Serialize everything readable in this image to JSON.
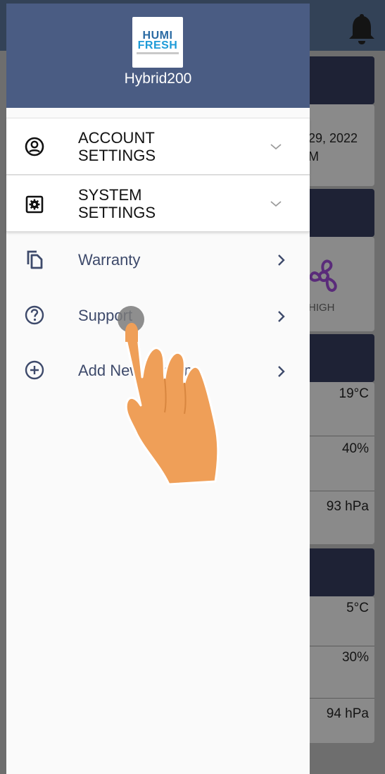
{
  "app": {
    "device_name": "Hybrid200",
    "logo": {
      "line1": "HUMI",
      "line2": "FRESH"
    }
  },
  "drawer": {
    "sections": [
      {
        "label": "ACCOUNT\nSETTINGS",
        "icon": "account-circle-icon",
        "expand_icon": "chevron-down-icon"
      },
      {
        "label": "SYSTEM\nSETTINGS",
        "icon": "settings-gear-box-icon",
        "expand_icon": "chevron-down-icon"
      }
    ],
    "items": [
      {
        "label": "Warranty",
        "icon": "copy-document-icon",
        "trailing_icon": "chevron-right-icon"
      },
      {
        "label": "Support",
        "icon": "help-circle-icon",
        "trailing_icon": "chevron-right-icon"
      },
      {
        "label": "Add New System",
        "icon": "add-circle-icon",
        "trailing_icon": "chevron-right-icon"
      }
    ]
  },
  "background": {
    "date_text": "29, 2022",
    "date_sub": "M",
    "fan_level": "HIGH",
    "indoor": {
      "temperature": "19°C",
      "humidity": "40%",
      "pressure": "93 hPa"
    },
    "outdoor": {
      "temperature": "5°C",
      "humidity": "30%",
      "pressure": "94 hPa"
    }
  },
  "overlay": {
    "gesture": "tap-hand-icon"
  },
  "colors": {
    "drawer_header": "#4a5c83",
    "item_text": "#3e4a6b",
    "scrim": "#6e6e6e",
    "app_bar": "#334257",
    "hand": "#ef9f58"
  }
}
